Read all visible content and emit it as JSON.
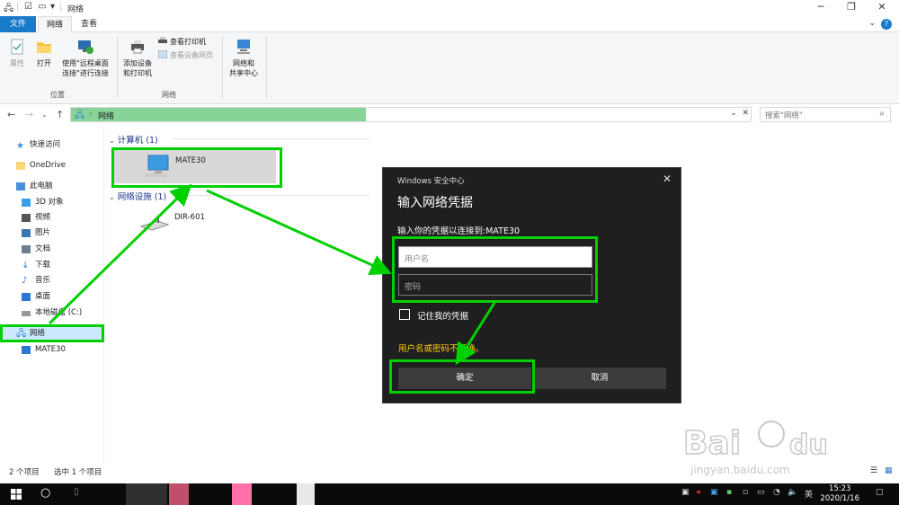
{
  "window": {
    "title": "网络"
  },
  "ribbon_tabs": [
    "文件",
    "网络",
    "查看"
  ],
  "ribbon": {
    "location_group": {
      "label": "位置",
      "buttons": [
        "属性",
        "打开",
        "使用\"远程桌面",
        "连接\"进行连接"
      ]
    },
    "network_group": {
      "label": "网络",
      "add_device": [
        "添加设备",
        "和打印机"
      ],
      "view_printers": "查看打印机",
      "view_device_web": "查看设备网页",
      "network_center": [
        "网络和",
        "共享中心"
      ]
    }
  },
  "address": {
    "path": "网络",
    "search_placeholder": "搜索\"网络\""
  },
  "nav_pane": {
    "items": [
      {
        "label": "快速访问",
        "icon": "star-icon",
        "color": "#3d8fe0"
      },
      {
        "label": "OneDrive",
        "icon": "folder-icon",
        "color": "#f7d77a"
      },
      {
        "label": "此电脑",
        "icon": "computer-icon",
        "color": "#4a90d9"
      },
      {
        "label": "3D 对象",
        "icon": "cube-icon",
        "color": "#3aa0e6"
      },
      {
        "label": "视频",
        "icon": "video-icon",
        "color": "#555555"
      },
      {
        "label": "图片",
        "icon": "picture-icon",
        "color": "#3c78b4"
      },
      {
        "label": "文档",
        "icon": "document-icon",
        "color": "#6b7d8c"
      },
      {
        "label": "下载",
        "icon": "download-icon",
        "color": "#2b78d4"
      },
      {
        "label": "音乐",
        "icon": "music-icon",
        "color": "#2b78d4"
      },
      {
        "label": "桌面",
        "icon": "desktop-icon",
        "color": "#2b78d4"
      },
      {
        "label": "本地磁盘 (C:)",
        "icon": "drive-icon",
        "color": "#777777"
      },
      {
        "label": "网络",
        "icon": "network-icon",
        "color": "#2b78d4"
      },
      {
        "label": "MATE30",
        "icon": "monitor-icon",
        "color": "#2b78d4"
      }
    ]
  },
  "content": {
    "computers_header": "计算机 (1)",
    "computer_item": "MATE30",
    "devices_header": "网络设施 (1)",
    "device_item": "DIR-601"
  },
  "dialog": {
    "app": "Windows 安全中心",
    "heading": "输入网络凭据",
    "subtitle": "输入你的凭据以连接到:MATE30",
    "username_placeholder": "用户名",
    "password_placeholder": "密码",
    "remember": "记住我的凭据",
    "error": "用户名或密码不正确。",
    "ok": "确定",
    "cancel": "取消"
  },
  "status": {
    "count": "2 个项目",
    "selected": "选中 1 个项目"
  },
  "taskbar": {
    "time": "15:23",
    "date": "2020/1/16",
    "ime": "英"
  },
  "colors": {
    "highlight": "#00d000",
    "accent": "#1979ca",
    "error": "#ffd400"
  }
}
